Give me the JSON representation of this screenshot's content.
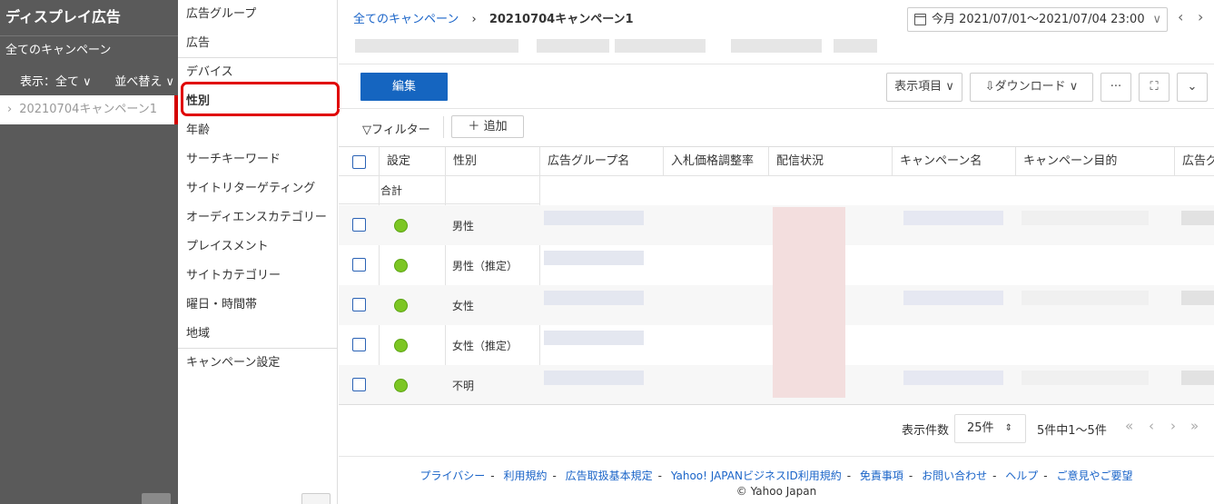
{
  "left_panel": {
    "title": "ディスプレイ広告",
    "all_campaigns": "全てのキャンペーン",
    "display_filter": "表示：全て",
    "sort": "並べ替え",
    "campaign_item": "20210704キャンペーン1"
  },
  "menu": {
    "items": [
      "広告グループ",
      "広告",
      "デバイス",
      "性別",
      "年齢",
      "サーチキーワード",
      "サイトリターゲティング",
      "オーディエンスカテゴリー",
      "プレイスメント",
      "サイトカテゴリー",
      "曜日・時間帯",
      "地域",
      "キャンペーン設定"
    ],
    "active_index": 3
  },
  "breadcrumb": {
    "root": "全てのキャンペーン",
    "current": "20210704キャンペーン1"
  },
  "date_range": "今月 2021/07/01〜2021/07/04 23:00",
  "toolbar": {
    "edit": "編集",
    "columns": "表示項目",
    "download": "ダウンロード",
    "more": "···"
  },
  "filter": {
    "label": "フィルター",
    "add": "追加"
  },
  "table": {
    "headers": [
      "設定",
      "性別",
      "広告グループ名",
      "入札価格調整率",
      "配信状況",
      "キャンペーン名",
      "キャンペーン目的",
      "広告グル"
    ],
    "total_label": "合計",
    "rows": [
      {
        "sex": "男性"
      },
      {
        "sex": "男性（推定）"
      },
      {
        "sex": "女性"
      },
      {
        "sex": "女性（推定）"
      },
      {
        "sex": "不明"
      }
    ]
  },
  "pagination": {
    "label": "表示件数",
    "per_page": "25件",
    "count": "5件中1〜5件"
  },
  "footer": {
    "links": [
      "プライバシー",
      "利用規約",
      "広告取扱基本規定",
      "Yahoo! JAPANビジネスID利用規約",
      "免責事項",
      "お問い合わせ",
      "ヘルプ",
      "ご意見やご要望"
    ],
    "copyright": "© Yahoo Japan"
  },
  "colors": {
    "primary": "#1565c0",
    "status_green": "#7cc623",
    "highlight_red": "#e00000",
    "sidebar_dark": "#5a5a5a"
  }
}
